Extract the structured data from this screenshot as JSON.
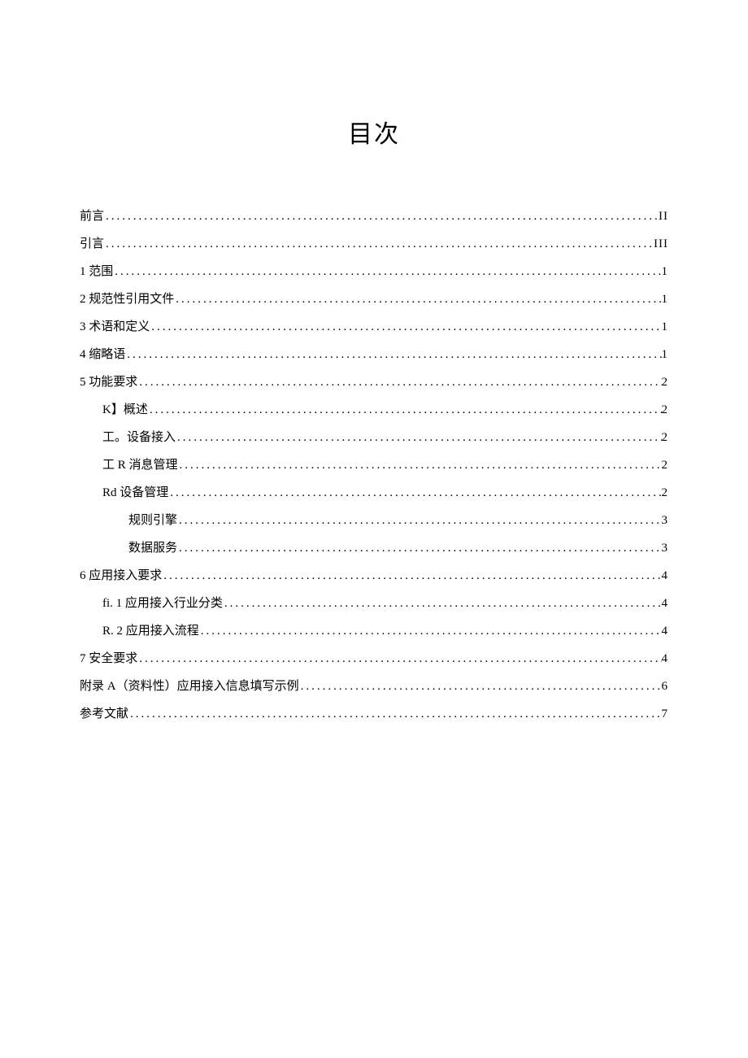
{
  "title": "目次",
  "entries": [
    {
      "level": 0,
      "label": "前言",
      "page": "II"
    },
    {
      "level": 0,
      "label": "引言",
      "page": "III"
    },
    {
      "level": 0,
      "label": "1 范围",
      "page": "1"
    },
    {
      "level": 0,
      "label": "2 规范性引用文件",
      "page": "1"
    },
    {
      "level": 0,
      "label": "3 术语和定义",
      "page": "1"
    },
    {
      "level": 0,
      "label": "4 缩略语",
      "page": "1"
    },
    {
      "level": 0,
      "label": "5 功能要求",
      "page": "2"
    },
    {
      "level": 1,
      "label": "K】概述",
      "page": "2"
    },
    {
      "level": 1,
      "label": "工。设备接入",
      "page": "2"
    },
    {
      "level": 1,
      "label": "工 R 消息管理",
      "page": "2"
    },
    {
      "level": 1,
      "label": "Rd 设备管理",
      "page": "2"
    },
    {
      "level": 2,
      "label": "规则引擎",
      "page": "3"
    },
    {
      "level": 2,
      "label": "数据服务",
      "page": "3"
    },
    {
      "level": 0,
      "label": "6 应用接入要求",
      "page": "4"
    },
    {
      "level": 1,
      "label": "fi. 1 应用接入行业分类",
      "page": "4"
    },
    {
      "level": 1,
      "label": "R. 2 应用接入流程",
      "page": "4"
    },
    {
      "level": 0,
      "label": "7 安全要求",
      "page": "4"
    },
    {
      "level": 0,
      "label": "附录 A（资料性）应用接入信息填写示例",
      "page": "6"
    },
    {
      "level": 0,
      "label": "参考文献",
      "page": "7"
    }
  ]
}
